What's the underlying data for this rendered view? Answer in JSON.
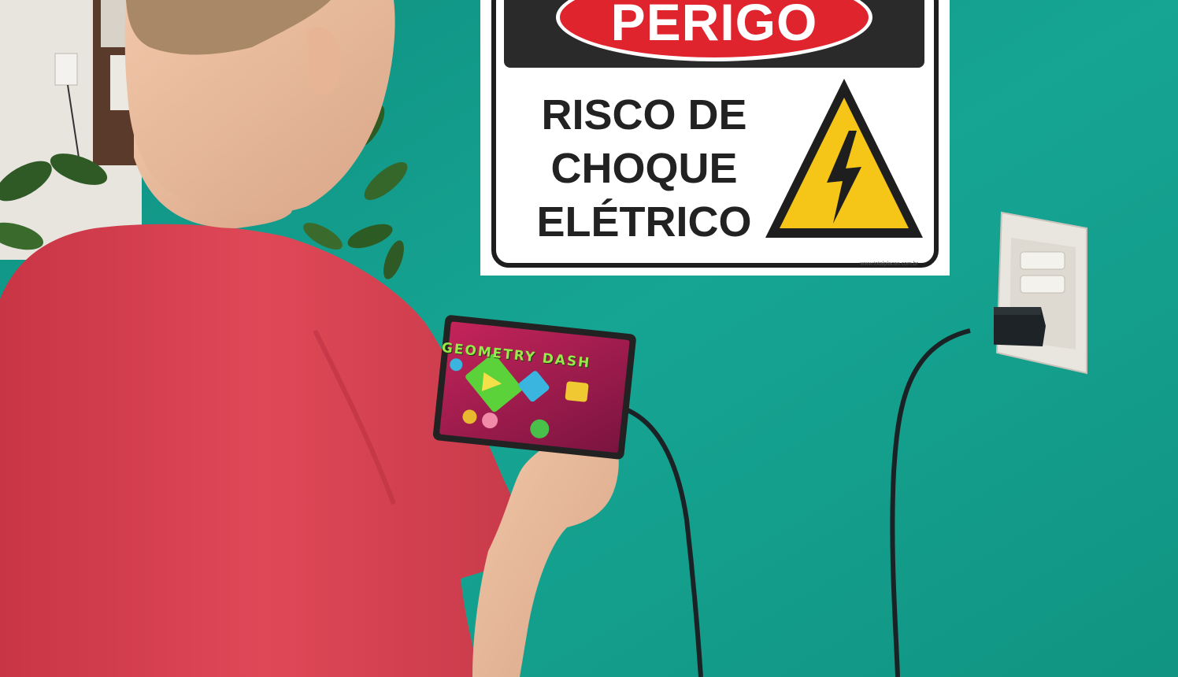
{
  "sign": {
    "title": "PERIGO",
    "lines": [
      "RISCO DE",
      "CHOQUE",
      "ELÉTRICO"
    ],
    "website": "www.totalplacas.com.br",
    "icon": "electric-hazard-icon",
    "colors": {
      "danger_red": "#e0242e",
      "header_black": "#2a2a2a",
      "warning_yellow": "#f5c518"
    }
  },
  "tablet": {
    "game_title": "GEOMETRY DASH"
  },
  "scene_colors": {
    "wall": "#14a08e",
    "shirt": "#d8414f",
    "cable": "#1b2226"
  }
}
